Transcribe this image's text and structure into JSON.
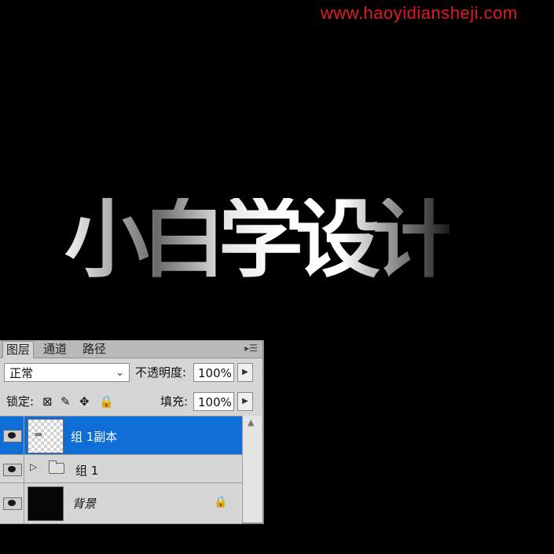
{
  "watermark": "www.haoyidiansheji.com",
  "canvas_text": "小白学设计",
  "panel": {
    "tabs": [
      "图层",
      "通道",
      "路径"
    ],
    "menu_icon": "panel-menu-icon",
    "blend_mode": "正常",
    "opacity_label": "不透明度:",
    "opacity_value": "100%",
    "lock_label": "锁定:",
    "fill_label": "填充:",
    "fill_value": "100%",
    "layers": [
      {
        "name": "组 1副本",
        "selected": true,
        "visible": true
      },
      {
        "name": "组 1",
        "type": "group",
        "visible": true
      },
      {
        "name": "背景",
        "locked": true,
        "visible": true
      }
    ]
  },
  "colors": {
    "watermark": "#e21b1b",
    "selection": "#0f6dd6",
    "panel_bg": "#d6d6d6"
  }
}
